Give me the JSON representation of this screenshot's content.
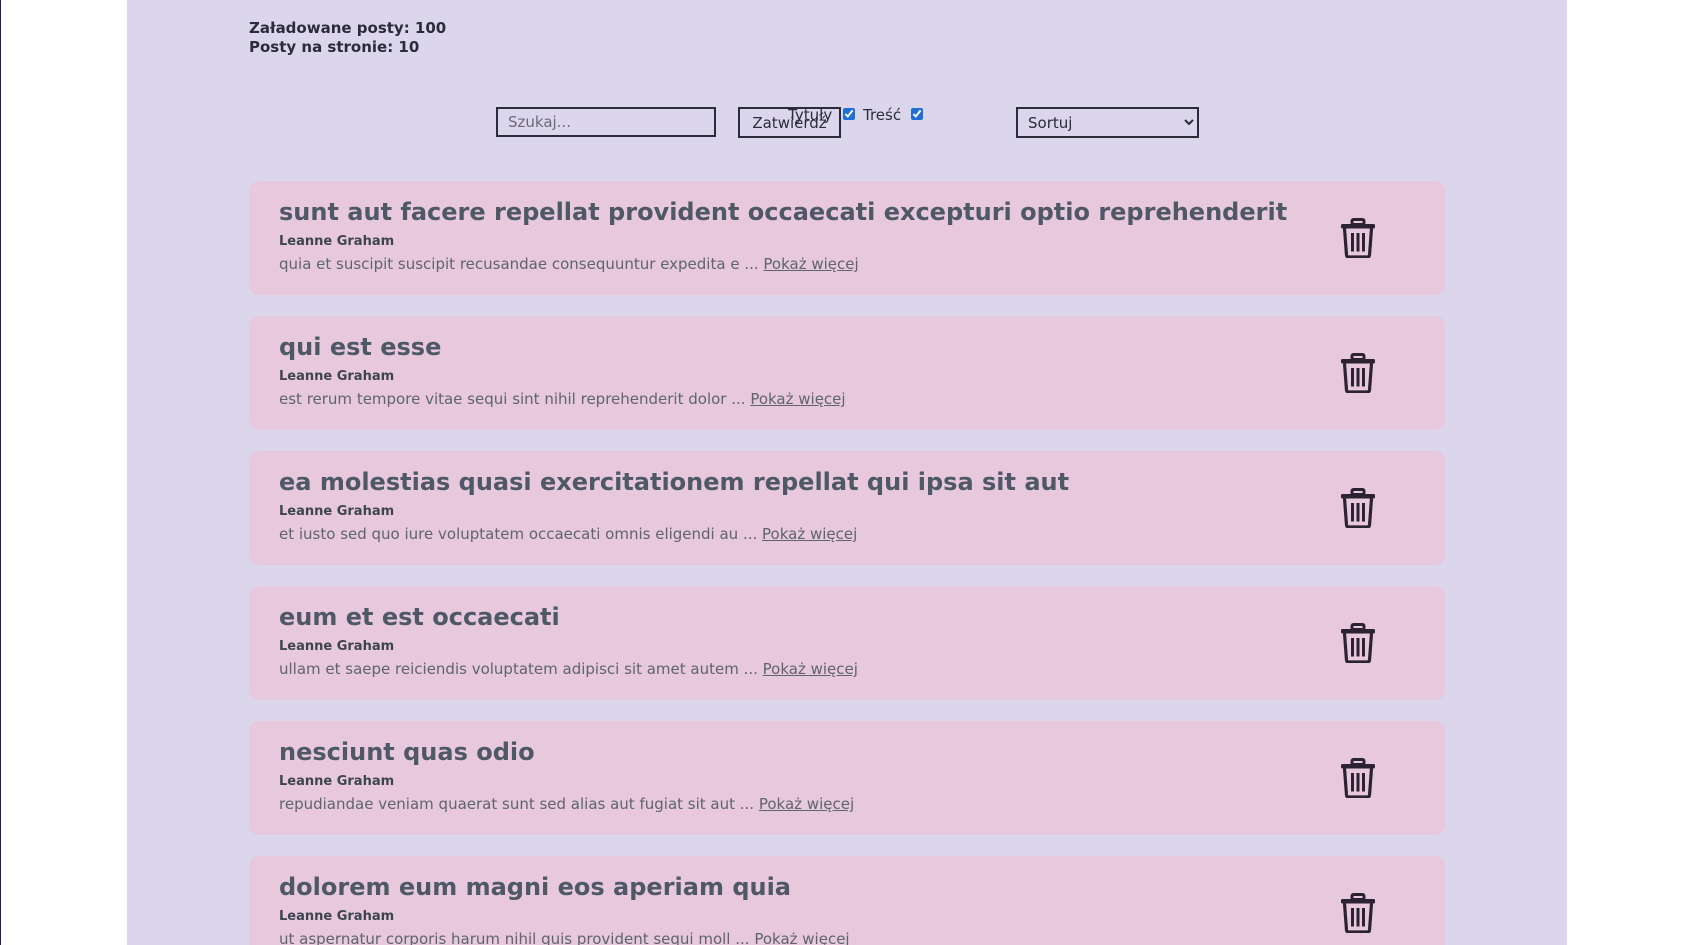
{
  "stats": {
    "loaded_posts": "Załadowane posty: 100",
    "posts_per_page": "Posty na stronie: 10"
  },
  "controls": {
    "search_placeholder": "Szukaj...",
    "submit_label": "Zatwierdź",
    "titles_label": "Tytuły",
    "titles_checked": true,
    "content_label": "Treść",
    "content_checked": true,
    "sort_selected": "Sortuj",
    "accent_color": "#1f6fd6"
  },
  "colors": {
    "background": "#dcd6ed",
    "card": "#e7c8dd",
    "title_text": "#4e5866"
  },
  "posts": [
    {
      "title": "sunt aut facere repellat provident occaecati excepturi optio reprehenderit",
      "author": "Leanne Graham",
      "body": "quia et suscipit suscipit recusandae consequuntur expedita e ...",
      "show_more": "Pokaż więcej",
      "delete_icon": "trash-icon"
    },
    {
      "title": "qui est esse",
      "author": "Leanne Graham",
      "body": "est rerum tempore vitae sequi sint nihil reprehenderit dolor ...",
      "show_more": "Pokaż więcej",
      "delete_icon": "trash-icon"
    },
    {
      "title": "ea molestias quasi exercitationem repellat qui ipsa sit aut",
      "author": "Leanne Graham",
      "body": "et iusto sed quo iure voluptatem occaecati omnis eligendi au ...",
      "show_more": "Pokaż więcej",
      "delete_icon": "trash-icon"
    },
    {
      "title": "eum et est occaecati",
      "author": "Leanne Graham",
      "body": "ullam et saepe reiciendis voluptatem adipisci sit amet autem ...",
      "show_more": "Pokaż więcej",
      "delete_icon": "trash-icon"
    },
    {
      "title": "nesciunt quas odio",
      "author": "Leanne Graham",
      "body": "repudiandae veniam quaerat sunt sed alias aut fugiat sit aut ...",
      "show_more": "Pokaż więcej",
      "delete_icon": "trash-icon"
    },
    {
      "title": "dolorem eum magni eos aperiam quia",
      "author": "Leanne Graham",
      "body": "ut aspernatur corporis harum nihil quis provident sequi moll ...",
      "show_more": "Pokaż więcej",
      "delete_icon": "trash-icon"
    }
  ]
}
